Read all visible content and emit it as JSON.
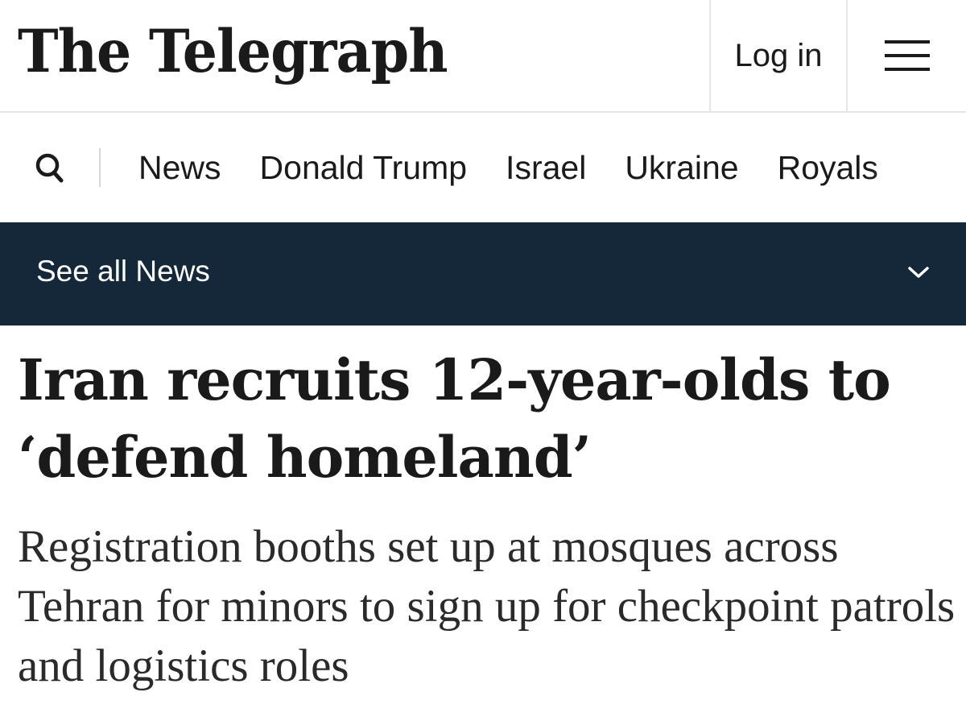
{
  "header": {
    "logo_text": "The Telegraph",
    "login_label": "Log in",
    "menu_icon": "hamburger-menu-icon"
  },
  "nav": {
    "search_icon": "search-icon",
    "items": [
      {
        "label": "News"
      },
      {
        "label": "Donald Trump"
      },
      {
        "label": "Israel"
      },
      {
        "label": "Ukraine"
      },
      {
        "label": "Royals"
      }
    ]
  },
  "section_bar": {
    "label": "See all News",
    "icon": "chevron-down-icon",
    "background": "#14283a"
  },
  "article": {
    "headline": "Iran recruits 12-year-olds to ‘defend homeland’",
    "standfirst": "Registration booths set up at mosques across Tehran for minors to sign up for checkpoint patrols and logistics roles"
  }
}
